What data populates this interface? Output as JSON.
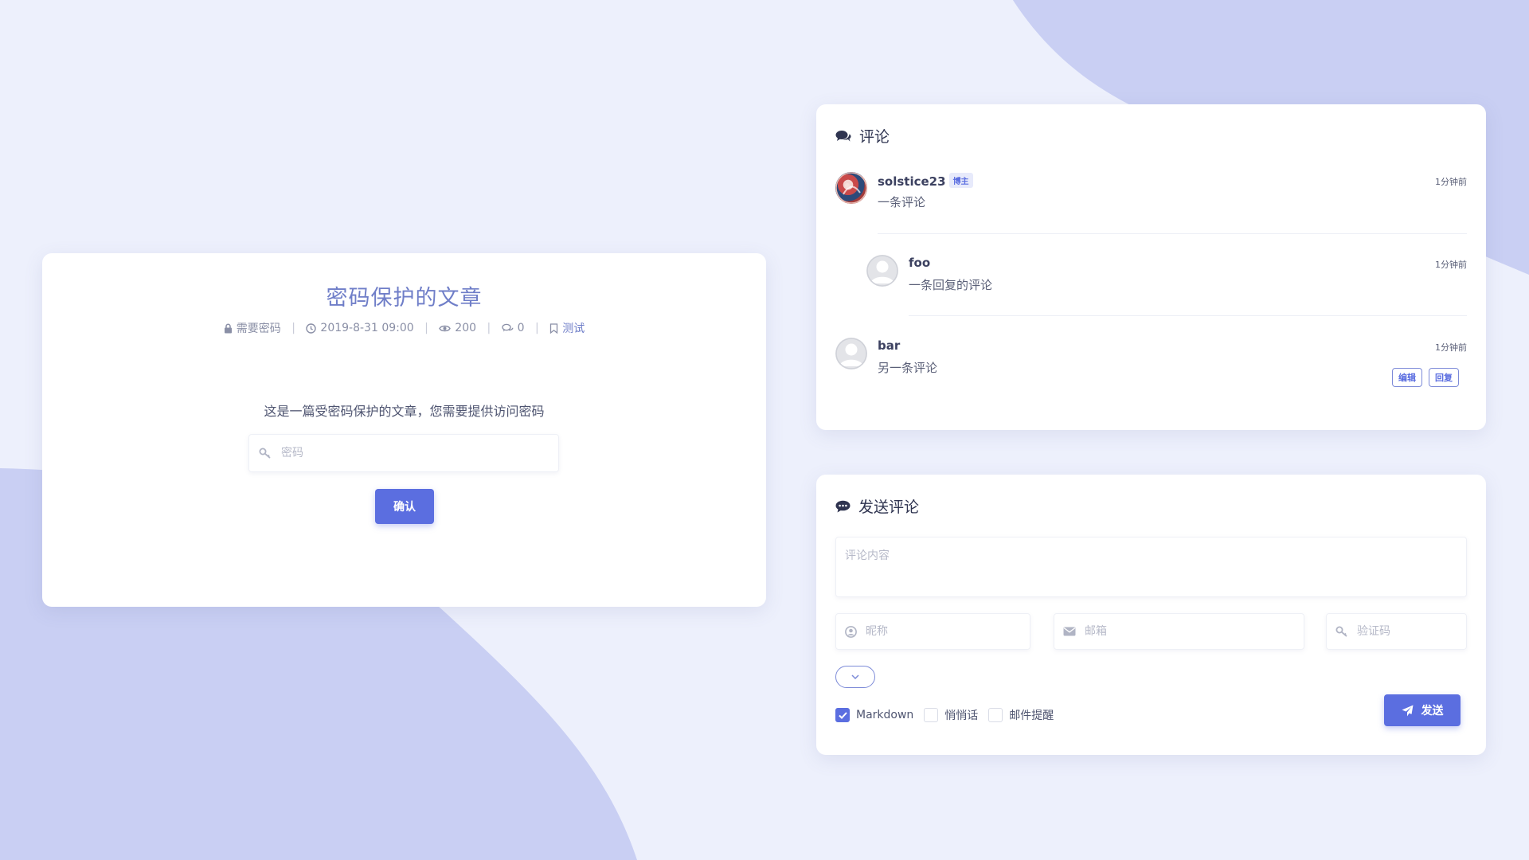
{
  "post": {
    "title": "密码保护的文章",
    "meta": {
      "lock_label": "需要密码",
      "datetime": "2019-8-31 09:00",
      "views": "200",
      "comments": "0",
      "tag": "测试"
    },
    "notice": "这是一篇受密码保护的文章，您需要提供访问密码",
    "password_placeholder": "密码",
    "confirm_label": "确认"
  },
  "comments": {
    "heading": "评论",
    "items": [
      {
        "author": "solstice23",
        "badge": "博主",
        "text": "一条评论",
        "time": "1分钟前"
      },
      {
        "author": "foo",
        "text": "一条回复的评论",
        "time": "1分钟前"
      },
      {
        "author": "bar",
        "text": "另一条评论",
        "time": "1分钟前",
        "edit_label": "编辑",
        "reply_label": "回复"
      }
    ]
  },
  "send": {
    "heading": "发送评论",
    "content_placeholder": "评论内容",
    "nickname_placeholder": "昵称",
    "email_placeholder": "邮箱",
    "captcha_placeholder": "验证码",
    "options": {
      "markdown": "Markdown",
      "whisper": "悄悄话",
      "mail_notify": "邮件提醒"
    },
    "markdown_checked": true,
    "whisper_checked": false,
    "mail_notify_checked": false,
    "send_label": "发送"
  },
  "colors": {
    "accent": "#5b6ee0",
    "background": "#edf0fc",
    "blob": "#c9cff3",
    "title": "#6f7ec8"
  }
}
